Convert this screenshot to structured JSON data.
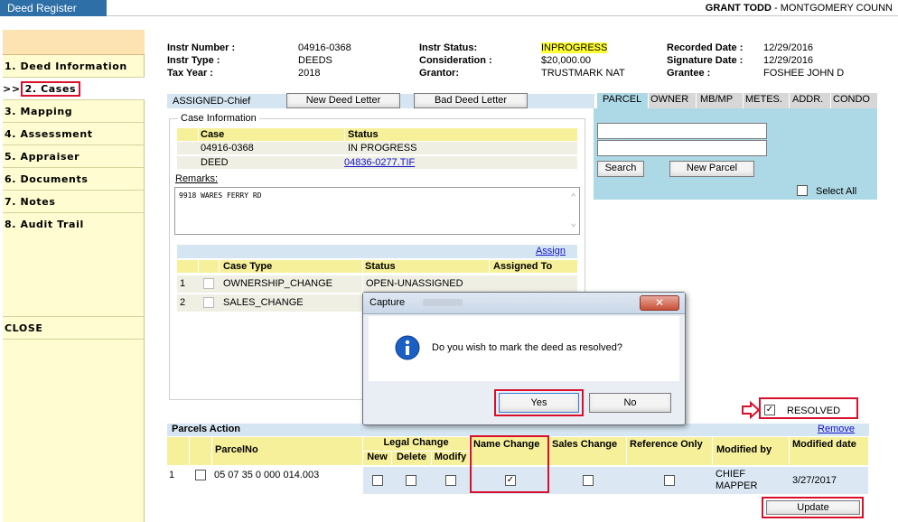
{
  "app": {
    "title": "Deed Register",
    "user": "GRANT TODD",
    "location": "- MONTGOMERY COUNN"
  },
  "sidebar": {
    "items": [
      {
        "label": "1. Deed Information"
      },
      {
        "label": "2. Cases",
        "prefix": ">>"
      },
      {
        "label": "3. Mapping"
      },
      {
        "label": "4. Assessment"
      },
      {
        "label": "5. Appraiser"
      },
      {
        "label": "6. Documents"
      },
      {
        "label": "7. Notes"
      },
      {
        "label": "8. Audit Trail"
      }
    ],
    "close_label": "CLOSE"
  },
  "header": {
    "instr_number_label": "Instr Number :",
    "instr_number": "04916-0368",
    "instr_type_label": "Instr Type :",
    "instr_type": "DEEDS",
    "tax_year_label": "Tax Year :",
    "tax_year": "2018",
    "instr_status_label": "Instr Status:",
    "instr_status": "INPROGRESS",
    "consideration_label": "Consideration :",
    "consideration": "$20,000.00",
    "grantor_label": "Grantor:",
    "grantor": "TRUSTMARK NAT",
    "recorded_date_label": "Recorded Date :",
    "recorded_date": "12/29/2016",
    "signature_date_label": "Signature Date :",
    "signature_date": "12/29/2016",
    "grantee_label": "Grantee :",
    "grantee": "FOSHEE JOHN D"
  },
  "assign_bar": {
    "label": "ASSIGNED-Chief",
    "new_letter": "New Deed Letter",
    "bad_letter": "Bad Deed Letter"
  },
  "case_info": {
    "legend": "Case Information",
    "headers": [
      "Case",
      "Status"
    ],
    "rows": [
      {
        "case": "04916-0368",
        "status": "IN PROGRESS"
      },
      {
        "case": "DEED",
        "status": " 04836-0277.TIF"
      }
    ],
    "remarks_label": "Remarks:",
    "remarks": "9918 WARES FERRY RD",
    "assign_link": "Assign",
    "case_headers": [
      "Case Type",
      "Status",
      "Assigned To"
    ],
    "cases": [
      {
        "num": "1",
        "type": "OWNERSHIP_CHANGE",
        "status": "OPEN-UNASSIGNED"
      },
      {
        "num": "2",
        "type": "SALES_CHANGE",
        "status": ""
      }
    ]
  },
  "search": {
    "tabs": [
      "PARCEL",
      "OWNER",
      "MB/MP",
      "METES.",
      "ADDR.",
      "CONDO"
    ],
    "search_button": "Search",
    "new_parcel_button": "New Parcel",
    "select_all": "Select All"
  },
  "dialog": {
    "title": "Capture",
    "message": "Do you wish to mark the deed as resolved?",
    "yes": "Yes",
    "no": "No"
  },
  "resolved": {
    "label": "RESOLVED",
    "checked": true
  },
  "parcels": {
    "title": "Parcels Action",
    "remove_link": "Remove",
    "col_parcel": "ParcelNo",
    "legal_change": "Legal Change",
    "col_new": "New",
    "col_delete": "Delete",
    "col_modify": "Modify",
    "col_name_change": "Name Change",
    "col_sales_change": "Sales Change",
    "col_reference_only": "Reference Only",
    "col_modified_by": "Modified by",
    "col_modified_date": "Modified date",
    "rows": [
      {
        "num": "1",
        "parcel": "05 07 35 0 000 014.003",
        "modified_by": "CHIEF MAPPER",
        "modified_date": "3/27/2017",
        "name_change": true
      }
    ],
    "update_button": "Update"
  },
  "colors": {
    "accent": "#2f6fa8",
    "highlight": "#ffff33",
    "annotation": "#d8102b",
    "panel": "#add8e6"
  }
}
